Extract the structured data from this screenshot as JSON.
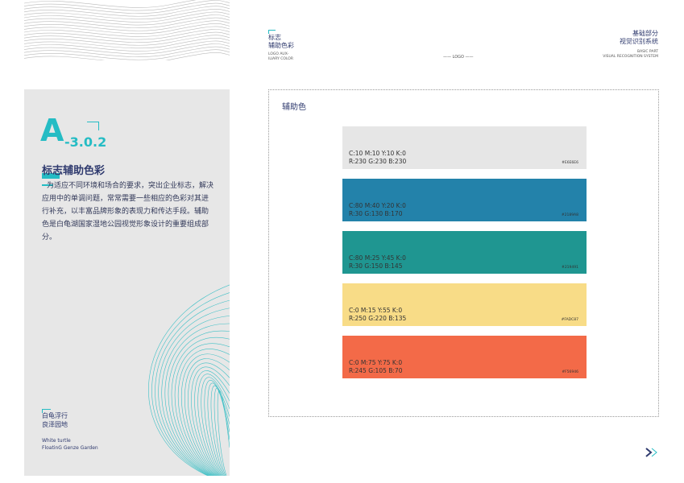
{
  "header": {
    "left_cn_line1": "标志",
    "left_cn_line2": "辅助色彩",
    "left_en_line1": "LOGO AUX-",
    "left_en_line2": "ILIARY COLOR",
    "center_label": "LOGO",
    "right_cn_line1": "基础部分",
    "right_cn_line2": "视觉识别系统",
    "right_en_line1": "BASIC PART",
    "right_en_line2": "VISUAL RECOGNITION SYSTEM"
  },
  "left_panel": {
    "letter": "A",
    "code": "-3.0.2",
    "title": "标志辅助色彩",
    "body": "为适应不同环境和场合的要求，突出企业标志，解决应用中的单调问题，常常需要一些相应的色彩对其进行补充，以丰富品牌形象的表现力和传达手段。辅助色是白龟湖国家湿地公园视觉形象设计的重要组成部分。",
    "brand_cn_line1": "白龟浮行",
    "brand_cn_line2": "良泽园地",
    "brand_en_line1": "White turtle",
    "brand_en_line2": "FloatinG Genze Garden",
    "accent_color": "#25bcc4"
  },
  "main": {
    "title": "辅助色",
    "swatches": [
      {
        "color": "#e6e6e6",
        "cmyk": "C:10 M:10 Y:10 K:0",
        "rgb": "R:230 G:230 B:230",
        "hex": "#E6E6E6"
      },
      {
        "color": "#2382aa",
        "cmyk": "C:80 M:40 Y:20 K:0",
        "rgb": "R:30 G:130 B:170",
        "hex": "#2189A8"
      },
      {
        "color": "#1f9691",
        "cmyk": "C:80 M:25 Y:45 K:0",
        "rgb": "R:30 G:150 B:145",
        "hex": "#219491"
      },
      {
        "color": "#f8dc87",
        "cmyk": "C:0 M:15 Y:55 K:0",
        "rgb": "R:250 G:220 B:135",
        "hex": "#FADC87"
      },
      {
        "color": "#f36a48",
        "cmyk": "C:0 M:75 Y:75 K:0",
        "rgb": "R:245 G:105 B:70",
        "hex": "#F56946"
      }
    ]
  }
}
